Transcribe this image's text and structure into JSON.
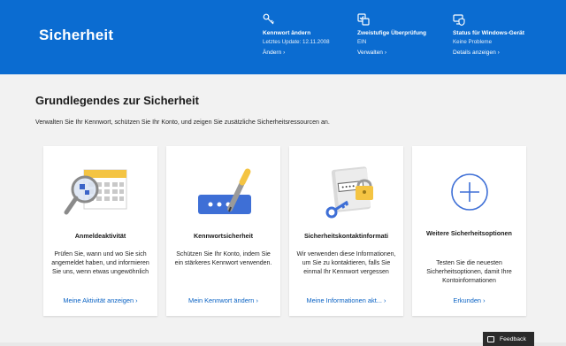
{
  "header": {
    "title": "Sicherheit",
    "items": [
      {
        "icon": "key-icon",
        "title": "Kennwort ändern",
        "sub": "Letztes Update: 12.11.2008",
        "link": "Ändern"
      },
      {
        "icon": "verification-icon",
        "title": "Zweistufige Überprüfung",
        "sub": "EIN",
        "link": "Verwalten"
      },
      {
        "icon": "device-shield-icon",
        "title": "Status für Windows-Gerät",
        "sub": "Keine Probleme",
        "link": "Details anzeigen"
      }
    ],
    "chevron": "›"
  },
  "main": {
    "title": "Grundlegendes zur Sicherheit",
    "description": "Verwalten Sie Ihr Kennwort, schützen Sie Ihr Konto, und zeigen Sie zusätzliche Sicherheitsressourcen an."
  },
  "cards": [
    {
      "icon": "calendar-magnifier-icon",
      "title": "Anmeldeaktivität",
      "desc": "Prüfen Sie, wann und wo Sie sich angemeldet haben, und informieren Sie uns, wenn etwas ungewöhnlich",
      "link": "Meine Aktivität anzeigen"
    },
    {
      "icon": "password-pen-icon",
      "title": "Kennwortsicherheit",
      "desc": "Schützen Sie Ihr Konto, indem Sie ein stärkeres Kennwort verwenden.",
      "link": "Mein Kennwort ändern"
    },
    {
      "icon": "contact-lock-icon",
      "title": "Sicherheitskontaktinformati",
      "desc": "Wir verwenden diese Informationen, um Sie zu kontaktieren, falls Sie einmal Ihr Kennwort vergessen",
      "link": "Meine Informationen akt..."
    },
    {
      "icon": "plus-circle-icon",
      "title": "Weitere Sicherheitsoptionen",
      "desc": "Testen Sie die neuesten Sicherheitsoptionen, damit Ihre Kontoinformationen",
      "link": "Erkunden"
    }
  ],
  "feedback": {
    "label": "Feedback"
  },
  "colors": {
    "header": "#0b6cd1",
    "link": "#0b63c4",
    "accent_yellow": "#f4c443"
  }
}
